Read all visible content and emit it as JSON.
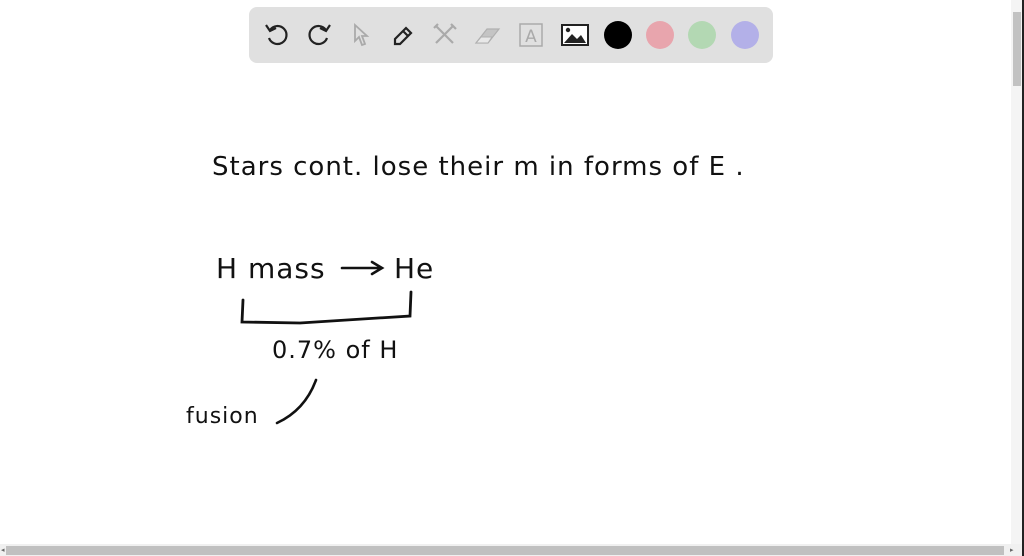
{
  "toolbar": {
    "tools": [
      {
        "name": "undo-icon",
        "enabled": true
      },
      {
        "name": "redo-icon",
        "enabled": true
      },
      {
        "name": "select-icon",
        "enabled": false
      },
      {
        "name": "pen-icon",
        "enabled": true
      },
      {
        "name": "tools-icon",
        "enabled": false
      },
      {
        "name": "eraser-icon",
        "enabled": false
      },
      {
        "name": "text-icon",
        "enabled": false
      },
      {
        "name": "image-icon",
        "enabled": true
      }
    ],
    "colors": [
      "#000000",
      "#e8a5ad",
      "#b3d8b3",
      "#b3b0e8"
    ],
    "text_tool_glyph": "A"
  },
  "canvas": {
    "line1": "Stars   cont. lose  their m  in forms of E .",
    "line2a": "H mass",
    "line2b": "He",
    "line3": "0.7%  of H",
    "line4": "fusion"
  }
}
